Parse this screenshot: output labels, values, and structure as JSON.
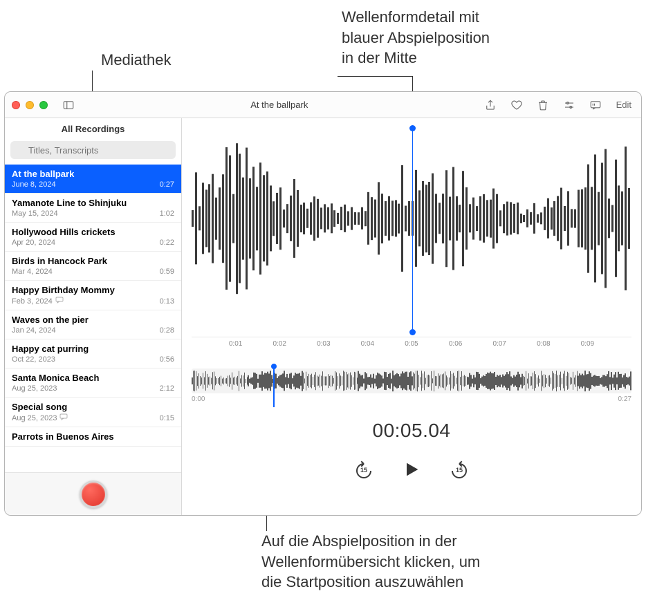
{
  "annotations": {
    "top_left": "Mediathek",
    "top_right_line1": "Wellenformdetail mit",
    "top_right_line2": "blauer Abspielposition",
    "top_right_line3": "in der Mitte",
    "bottom_line1": "Auf die Abspielposition in der",
    "bottom_line2": "Wellenformübersicht klicken, um",
    "bottom_line3": "die Startposition auszuwählen"
  },
  "window": {
    "title": "At the ballpark",
    "edit_label": "Edit"
  },
  "sidebar": {
    "header": "All Recordings",
    "search_placeholder": "Titles, Transcripts"
  },
  "recordings": [
    {
      "title": "At the ballpark",
      "date": "June 8, 2024",
      "duration": "0:27",
      "selected": true,
      "transcript": false
    },
    {
      "title": "Yamanote Line to Shinjuku",
      "date": "May 15, 2024",
      "duration": "1:02",
      "selected": false,
      "transcript": false
    },
    {
      "title": "Hollywood Hills crickets",
      "date": "Apr 20, 2024",
      "duration": "0:22",
      "selected": false,
      "transcript": false
    },
    {
      "title": "Birds in Hancock Park",
      "date": "Mar 4, 2024",
      "duration": "0:59",
      "selected": false,
      "transcript": false
    },
    {
      "title": "Happy Birthday Mommy",
      "date": "Feb 3, 2024",
      "duration": "0:13",
      "selected": false,
      "transcript": true
    },
    {
      "title": "Waves on the pier",
      "date": "Jan 24, 2024",
      "duration": "0:28",
      "selected": false,
      "transcript": false
    },
    {
      "title": "Happy cat purring",
      "date": "Oct 22, 2023",
      "duration": "0:56",
      "selected": false,
      "transcript": false
    },
    {
      "title": "Santa Monica Beach",
      "date": "Aug 25, 2023",
      "duration": "2:12",
      "selected": false,
      "transcript": false
    },
    {
      "title": "Special song",
      "date": "Aug 25, 2023",
      "duration": "0:15",
      "selected": false,
      "transcript": true
    },
    {
      "title": "Parrots in Buenos Aires",
      "date": "",
      "duration": "",
      "selected": false,
      "transcript": false
    }
  ],
  "detail": {
    "ticks": [
      "0:01",
      "0:02",
      "0:03",
      "0:04",
      "0:05",
      "0:06",
      "0:07",
      "0:08",
      "0:09"
    ],
    "overview_start": "0:00",
    "overview_end": "0:27",
    "current_time": "00:05.04",
    "skip_seconds": "15",
    "playhead_detail_percent": 50,
    "playhead_overview_percent": 18.5
  },
  "icons": {
    "sidebar_toggle": "sidebar-toggle-icon",
    "share": "share-icon",
    "favorite": "heart-icon",
    "trash": "trash-icon",
    "settings": "sliders-icon",
    "transcript": "transcript-icon",
    "search": "search-icon",
    "record": "record-icon",
    "skip_back": "skip-back-15-icon",
    "play": "play-icon",
    "skip_forward": "skip-forward-15-icon"
  }
}
